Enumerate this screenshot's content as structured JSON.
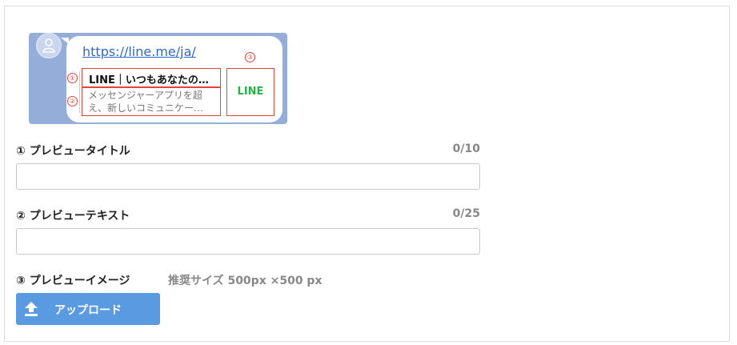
{
  "preview": {
    "url": "https://line.me/ja/",
    "title": "LINE｜いつもあなたの…",
    "text_line1": "メッセンジャーアプリを超",
    "text_line2": "え、新しいコミュニケー…",
    "image_label": "LINE",
    "markers": [
      "①",
      "②",
      "③"
    ]
  },
  "form": {
    "title_label": "① プレビュータイトル",
    "title_counter": "0/10",
    "title_value": "",
    "text_label": "② プレビューテキスト",
    "text_counter": "0/25",
    "text_value": "",
    "image_label": "③ プレビューイメージ",
    "image_hint": "推奨サイズ 500px ×500 px",
    "upload_label": "アップロード"
  },
  "colors": {
    "accent": "#5a9ae0",
    "marker": "#e0443a",
    "line_green": "#27b447"
  }
}
